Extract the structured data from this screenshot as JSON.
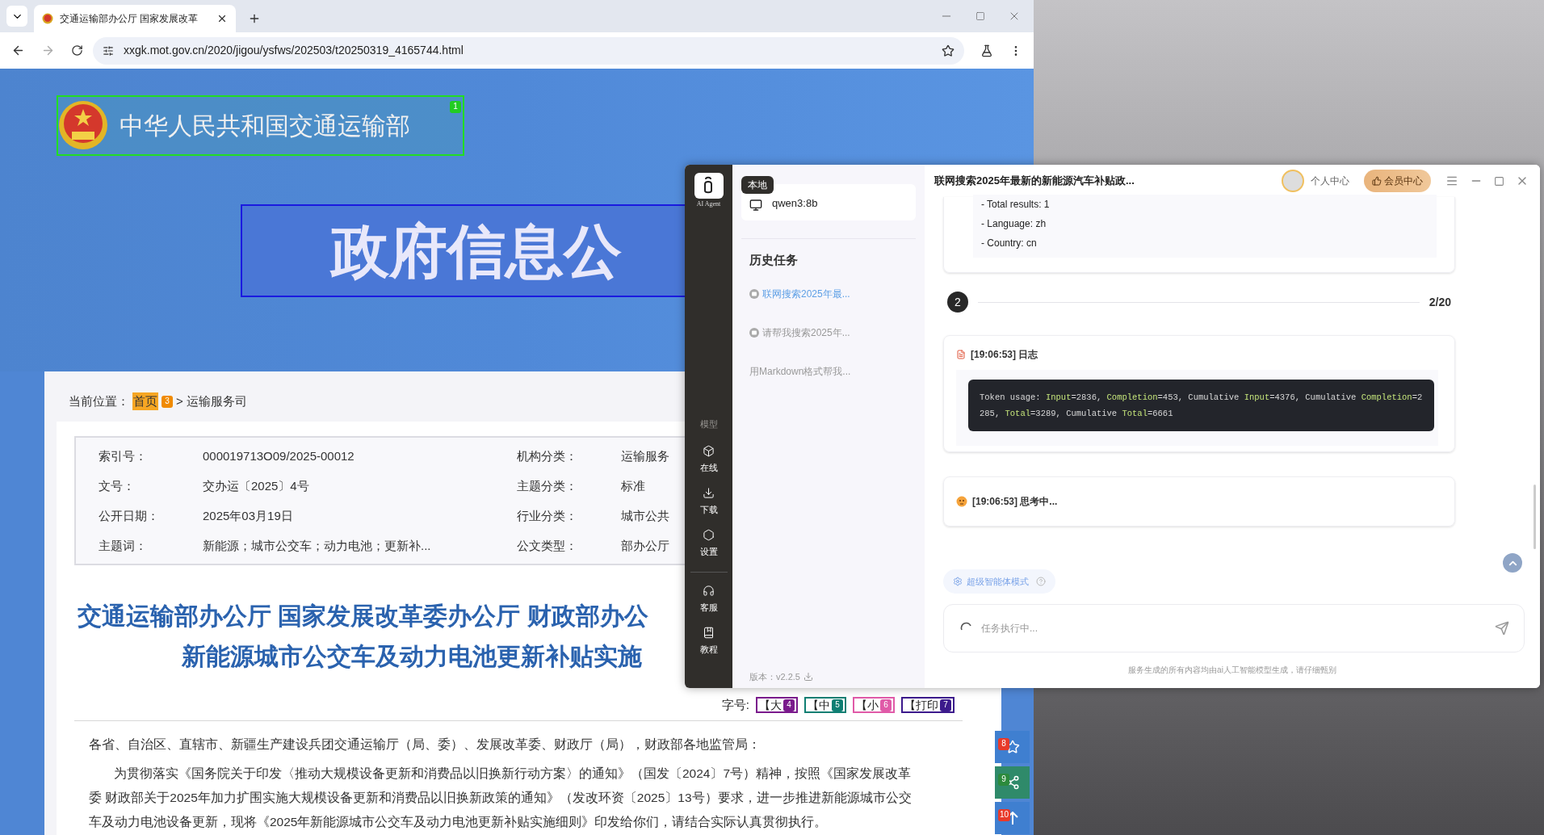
{
  "browser": {
    "tab": {
      "title": "交通运输部办公厅 国家发展改革"
    },
    "address": {
      "url": "xxgk.mot.gov.cn/2020/jigou/ysfws/202503/t20250319_4165744.html"
    }
  },
  "page": {
    "site_title": {
      "text": "中华人民共和国交通运输部",
      "badge": "1"
    },
    "banner": "政府信息公",
    "breadcrumb": {
      "label": "当前位置：",
      "home": "首页",
      "badge": "3",
      "separator": ">",
      "current": "运输服务司"
    },
    "meta": [
      {
        "label": "索引号：",
        "value": "000019713O09/2025-00012"
      },
      {
        "label": "机构分类：",
        "value": "运输服务"
      },
      {
        "label": "文号：",
        "value": "交办运〔2025〕4号"
      },
      {
        "label": "主题分类：",
        "value": "标准"
      },
      {
        "label": "公开日期：",
        "value": "2025年03月19日"
      },
      {
        "label": "行业分类：",
        "value": "城市公共"
      },
      {
        "label": "主题词：",
        "value": "新能源；城市公交车；动力电池；更新补..."
      },
      {
        "label": "公文类型：",
        "value": "部办公厅"
      }
    ],
    "title_lines": [
      "交通运输部办公厅 国家发展改革委办公厅 财政部办公",
      "新能源城市公交车及动力电池更新补贴实施"
    ],
    "font_size": {
      "label": "字号:",
      "options": [
        {
          "text": "【大",
          "badge": "4",
          "color": "#7a1a8c"
        },
        {
          "text": "【中",
          "badge": "5",
          "color": "#0f7f73"
        },
        {
          "text": "【小",
          "badge": "6",
          "color": "#e05aa8"
        },
        {
          "text": "【打印",
          "badge": "7",
          "color": "#3c1a8c"
        }
      ]
    },
    "paragraphs": [
      {
        "text": "各省、自治区、直辖市、新疆生产建设兵团交通运输厅（局、委）、发展改革委、财政厅（局），财政部各地监管局：",
        "indent": false
      },
      {
        "text": "为贯彻落实《国务院关于印发〈推动大规模设备更新和消费品以旧换新行动方案〉的通知》（国发〔2024〕7号）精神，按照《国家发展改革委 财政部关于2025年加力扩围实施大规模设备更新和消费品以旧换新政策的通知》（发改环资〔2025〕13号）要求，进一步推进新能源城市公交车及动力电池设备更新，现将《2025年新能源城市公交车及动力电池更新补贴实施细则》印发给你们，请结合实际认真贯彻执行。",
        "indent": true
      }
    ],
    "float_buttons": [
      {
        "kind": "star",
        "badge": "8",
        "color": "#3f7fd0"
      },
      {
        "kind": "share",
        "badge": "9",
        "color": "#2f8a6a"
      },
      {
        "kind": "top",
        "badge": "10",
        "color": "#3f7fd0"
      }
    ]
  },
  "agent": {
    "logo_caption": "AI Agent",
    "nav_heading": "模型",
    "nav": [
      {
        "label": "在线",
        "kind": "cube",
        "divider_above": false
      },
      {
        "label": "下载",
        "kind": "download",
        "divider_above": false
      },
      {
        "label": "设置",
        "kind": "settings",
        "divider_above": false
      },
      {
        "label": "客服",
        "kind": "headset",
        "divider_above": true
      },
      {
        "label": "教程",
        "kind": "book",
        "divider_above": false
      }
    ],
    "model": {
      "tag": "本地",
      "name": "qwen3:8b"
    },
    "history": {
      "title": "历史任务",
      "items": [
        {
          "text": "联网搜索2025年最...",
          "selected": true,
          "icon": true
        },
        {
          "text": "请帮我搜索2025年...",
          "selected": false,
          "icon": true
        },
        {
          "text": "用Markdown格式帮我...",
          "selected": false,
          "icon": false
        }
      ]
    },
    "version": "版本：v2.2.5",
    "title": "联网搜索2025年最新的新能源汽车补贴政...",
    "user_label": "个人中心",
    "vip_button": "会员中心",
    "result_lines": [
      "- Total results: 1",
      "- Language: zh",
      "- Country: cn"
    ],
    "step": {
      "number": "2",
      "count": "2/20"
    },
    "log": {
      "header": "[19:06:53] 日志",
      "segments": [
        {
          "text": "Token usage: ",
          "kind": "plain"
        },
        {
          "text": "Input",
          "kind": "key"
        },
        {
          "text": "=2836, ",
          "kind": "plain"
        },
        {
          "text": "Completion",
          "kind": "key"
        },
        {
          "text": "=453, Cumulative ",
          "kind": "plain"
        },
        {
          "text": "Input",
          "kind": "key"
        },
        {
          "text": "=4376, Cumulative ",
          "kind": "plain"
        },
        {
          "text": "Completion",
          "kind": "key"
        },
        {
          "text": "=2285, ",
          "kind": "plain"
        },
        {
          "text": "Total",
          "kind": "key"
        },
        {
          "text": "=3289, Cumulative ",
          "kind": "plain"
        },
        {
          "text": "Total",
          "kind": "key"
        },
        {
          "text": "=6661",
          "kind": "plain"
        }
      ]
    },
    "thinking": "[19:06:53] 思考中...",
    "mode": "超级智能体模式",
    "input": {
      "placeholder": "任务执行中..."
    },
    "footer": "服务生成的所有内容均由ai人工智能模型生成，请仔细甄别"
  }
}
